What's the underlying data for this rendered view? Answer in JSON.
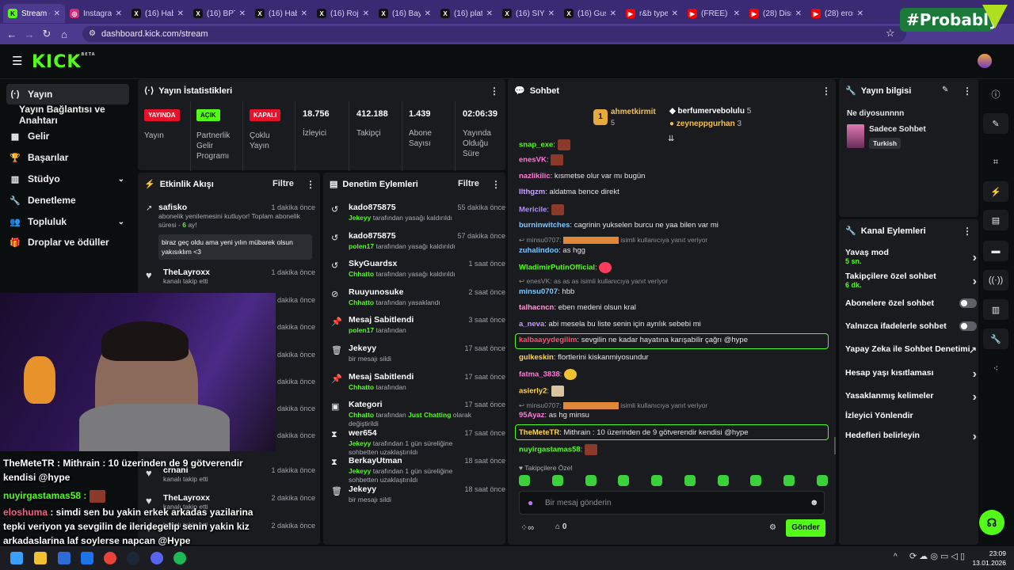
{
  "browser": {
    "tabs": [
      {
        "label": "Stream -",
        "icon": "kick-icon",
        "color": "#53fc18"
      },
      {
        "label": "Instagram",
        "icon": "instagram-icon",
        "color": "#d62976"
      },
      {
        "label": "(16) Hab",
        "icon": "x-icon",
        "color": "#ffffff"
      },
      {
        "label": "(16) BPT",
        "icon": "x-icon",
        "color": "#ffffff"
      },
      {
        "label": "(16) Hab",
        "icon": "x-icon",
        "color": "#ffffff"
      },
      {
        "label": "(16) Roja",
        "icon": "x-icon",
        "color": "#ffffff"
      },
      {
        "label": "(16) Bay",
        "icon": "x-icon",
        "color": "#ffffff"
      },
      {
        "label": "(16) plat",
        "icon": "x-icon",
        "color": "#ffffff"
      },
      {
        "label": "(16) SİYA",
        "icon": "x-icon",
        "color": "#ffffff"
      },
      {
        "label": "(16) Gus",
        "icon": "x-icon",
        "color": "#ffffff"
      },
      {
        "label": "r&b type",
        "icon": "youtube-icon",
        "color": "#ff0000"
      },
      {
        "label": "(FREE) R",
        "icon": "youtube-icon",
        "color": "#ff0000"
      },
      {
        "label": "(28) Diss",
        "icon": "youtube-icon",
        "color": "#ff0000"
      },
      {
        "label": "(28) eros",
        "icon": "youtube-icon",
        "color": "#ff0000"
      }
    ],
    "url": "dashboard.kick.com/stream",
    "probably": "#Probably"
  },
  "kick": {
    "logo": "KICK",
    "logo_sup": "BETA"
  },
  "sidebar": {
    "items": [
      {
        "label": "Yayın",
        "icon": "(·)"
      },
      {
        "label": "Yayın Bağlantısı ve Anahtarı",
        "icon": ""
      },
      {
        "label": "Gelir",
        "icon": "▦"
      },
      {
        "label": "Başarılar",
        "icon": "🏆"
      },
      {
        "label": "Stüdyo",
        "icon": "▥"
      },
      {
        "label": "Denetleme",
        "icon": "🔧"
      },
      {
        "label": "Topluluk",
        "icon": "👥"
      },
      {
        "label": "Droplar ve ödüller",
        "icon": "🎁"
      }
    ]
  },
  "stats": {
    "title": "Yayın İstatistikleri",
    "live_badge": "YAYINDA",
    "live_label": "Yayın",
    "partner_badge": "AÇIK",
    "partner_label": "Partnerlik Gelir Programı",
    "multi_badge": "KAPALI",
    "multi_label": "Çoklu Yayın",
    "viewers": "18.756",
    "viewers_label": "İzleyici",
    "followers": "412.188",
    "followers_label": "Takipçi",
    "subs": "1.439",
    "subs_label": "Abone Sayısı",
    "uptime": "02:06:39",
    "uptime_label": "Yayında Olduğu Süre"
  },
  "activity": {
    "title": "Etkinlik Akışı",
    "filter": "Filtre",
    "first": {
      "name": "safisko",
      "time": "1 dakika önce",
      "desc_a": "abonelik yenilemesini kutluyor! Toplam abonelik süresi - ",
      "months": "6",
      "desc_b": " ay!",
      "message": "biraz geç oldu ama yeni yılın mübarek olsun yakısıklım <3"
    },
    "items": [
      {
        "name": "TheLayroxx",
        "time": "1 dakika önce",
        "desc": "kanalı takip etti"
      },
      {
        "name": "",
        "time": "dakika önce",
        "desc": ""
      },
      {
        "name": "",
        "time": "dakika önce",
        "desc": ""
      },
      {
        "name": "",
        "time": "dakika önce",
        "desc": ""
      },
      {
        "name": "",
        "time": "dakika önce",
        "desc": ""
      },
      {
        "name": "",
        "time": "dakika önce",
        "desc": ""
      },
      {
        "name": "",
        "time": "dakika önce",
        "desc": "kanalı takip etti"
      },
      {
        "name": "crnani",
        "time": "1 dakika önce",
        "desc": "kanalı takip etti"
      },
      {
        "name": "TheLayroxx",
        "time": "2 dakika önce",
        "desc": "kanalı takip etti"
      },
      {
        "name": "",
        "time": "2 dakika önce",
        "desc": "kanalı takip etti"
      }
    ]
  },
  "moderation": {
    "title": "Denetim Eylemleri",
    "filter": "Filtre",
    "items": [
      {
        "icon": "↺",
        "name": "kado875875",
        "time": "55 dakika önce",
        "actor": "Jekeyy",
        "desc": " tarafından yasağı kaldırıldı"
      },
      {
        "icon": "↺",
        "name": "kado875875",
        "time": "57 dakika önce",
        "actor": "polen17",
        "desc": " tarafından yasağı kaldırıldı"
      },
      {
        "icon": "↺",
        "name": "SkyGuardsx",
        "time": "1 saat önce",
        "actor": "Chhatto",
        "desc": " tarafından yasağı kaldırıldı"
      },
      {
        "icon": "⊘",
        "name": "Ruuyunosuke",
        "time": "2 saat önce",
        "actor": "Chhatto",
        "desc": " tarafından yasaklandı"
      },
      {
        "icon": "📌",
        "name": "Mesaj Sabitlendi",
        "time": "3 saat önce",
        "actor": "polen17",
        "desc": " tarafından"
      },
      {
        "icon": "🗑",
        "name": "Jekeyy",
        "time": "17 saat önce",
        "actor": "",
        "desc": "bir mesajı sildi"
      },
      {
        "icon": "📌",
        "name": "Mesaj Sabitlendi",
        "time": "17 saat önce",
        "actor": "Chhatto",
        "desc": " tarafından"
      },
      {
        "icon": "▣",
        "name": "Kategori",
        "time": "17 saat önce",
        "actor": "Chhatto",
        "desc": " tarafından ",
        "extra": "Just Chatting",
        "desc2": " olarak değiştirildi"
      },
      {
        "icon": "⧗",
        "name": "wer654",
        "time": "17 saat önce",
        "actor": "Jekeyy",
        "desc": " tarafından 1 gün süreliğine sohbetten uzaklaştırıldı"
      },
      {
        "icon": "⧗",
        "name": "BerkayUtman",
        "time": "18 saat önce",
        "actor": "Jekeyy",
        "desc": " tarafından 1 gün süreliğine sohbetten uzaklaştırıldı"
      },
      {
        "icon": "🗑",
        "name": "Jekeyy",
        "time": "18 saat önce",
        "actor": "",
        "desc": "bir mesajı sildi"
      }
    ]
  },
  "chat": {
    "title": "Sohbet",
    "top": [
      {
        "rank": "1",
        "name": "ahmetkirmit",
        "count": "5"
      },
      {
        "name": "berfumervebolulu",
        "count": "5"
      },
      {
        "name": "zeyneppgurhan",
        "count": "3"
      }
    ],
    "messages": [
      {
        "user": "snap_exe",
        "color": "#53fc18",
        "text": ""
      },
      {
        "user": "enesVK",
        "color": "#ff7ad9",
        "text": ""
      },
      {
        "user": "nazlikilic",
        "color": "#ff7ad9",
        "text": "kısmetse olur var mı bugün"
      },
      {
        "user": "llthgzm",
        "color": "#c6a6ff",
        "text": "aldatma bence direkt"
      },
      {
        "user": "Mericile",
        "color": "#b38bff",
        "text": ""
      },
      {
        "user": "burninwitches",
        "color": "#7ec8ff",
        "text": "cagrinin yukselen burcu ne yaa bilen var mi"
      },
      {
        "user": "zuhalindoo",
        "color": "#7ec8ff",
        "text": "as hgg"
      },
      {
        "user": "WladimirPutinOfficial",
        "color": "#53fc18",
        "text": ""
      },
      {
        "user": "minsu0707",
        "color": "#7ec8ff",
        "text": "hbb"
      },
      {
        "user": "talhacncn",
        "color": "#ff9ad5",
        "text": "eben medeni olsun kral"
      },
      {
        "user": "a_neva",
        "color": "#c49bff",
        "text": "abi mesela bu liste senin için ayrılık sebebi mi"
      },
      {
        "user": "kalbaayydegilim",
        "color": "#ff4d6d",
        "text": "sevgilin ne kadar hayatına karışabilir çağrı @hype"
      },
      {
        "user": "gulkeskin",
        "color": "#ffd54a",
        "text": "flortlerini kiskanmiyosundur"
      },
      {
        "user": "fatma_3838",
        "color": "#ff7ad9",
        "text": ""
      },
      {
        "user": "asierly2",
        "color": "#ffd54a",
        "text": ""
      },
      {
        "user": "95Ayaz",
        "color": "#ff7ad9",
        "text": "as hg minsu"
      },
      {
        "user": "TheMeteTR",
        "color": "#ffd54a",
        "text": "Mithrain : 10 üzerinden de 9 götverendir kendisi @hype"
      },
      {
        "user": "nuyirgastamas58",
        "color": "#53fc18",
        "text": ""
      }
    ],
    "reply1": "minsu0707:",
    "reply1_b": "isimli kullanıcıya yanıt veriyor",
    "reply2": "enesVK: as as as isimli kullanıcıya yanıt veriyor",
    "reply3": "minsu0707:",
    "reply3_b": "isimli kullanıcıya yanıt veriyor",
    "followers_only": "Takipçilere Özel",
    "input_placeholder": "Bir mesaj gönderin",
    "points": "0",
    "send": "Gönder"
  },
  "streaminfo": {
    "title": "Yayın bilgisi",
    "stream_title": "Ne diyosunnnn",
    "category": "Sadece Sohbet",
    "tag": "Turkish"
  },
  "channel_actions": {
    "title": "Kanal Eylemleri",
    "items": [
      {
        "label": "Yavaş mod",
        "sub": "5 sn.",
        "control": "chevron"
      },
      {
        "label": "Takipçilere özel sohbet",
        "sub": "6 dk.",
        "control": "chevron"
      },
      {
        "label": "Abonelere özel sohbet",
        "sub": "",
        "control": "toggle"
      },
      {
        "label": "Yalnızca ifadelerle sohbet",
        "sub": "",
        "control": "toggle"
      },
      {
        "label": "Yapay Zeka ile Sohbet Denetimi",
        "sub": "",
        "control": "external"
      },
      {
        "label": "Hesap yaşı kısıtlaması",
        "sub": "",
        "control": "chevron"
      },
      {
        "label": "Yasaklanmış kelimeler",
        "sub": "",
        "control": "chevron"
      },
      {
        "label": "İzleyici Yönlendir",
        "sub": "",
        "control": "none"
      },
      {
        "label": "Hedefleri belirleyin",
        "sub": "",
        "control": "chevron"
      }
    ]
  },
  "overlay": {
    "line1": "TheMeteTR : Mithrain : 10 üzerinden de 9 götverendir kendisi @hype",
    "line2": "nuyirgastamas58 :",
    "line3_user": "eloshuma",
    "line3": " : simdi sen bu yakin erkek arkadas yazilarina tepki veriyon ya sevgilin de ileridegelip senin yakin kiz arkadaslarina laf soylerse napcan @Hype"
  },
  "taskbar": {
    "time": "23:09",
    "date": "13.01.2026"
  },
  "colors": {
    "accent": "#53fc18",
    "live": "#e4122a",
    "bg": "#0b0e0f",
    "panel": "#191b1f"
  }
}
